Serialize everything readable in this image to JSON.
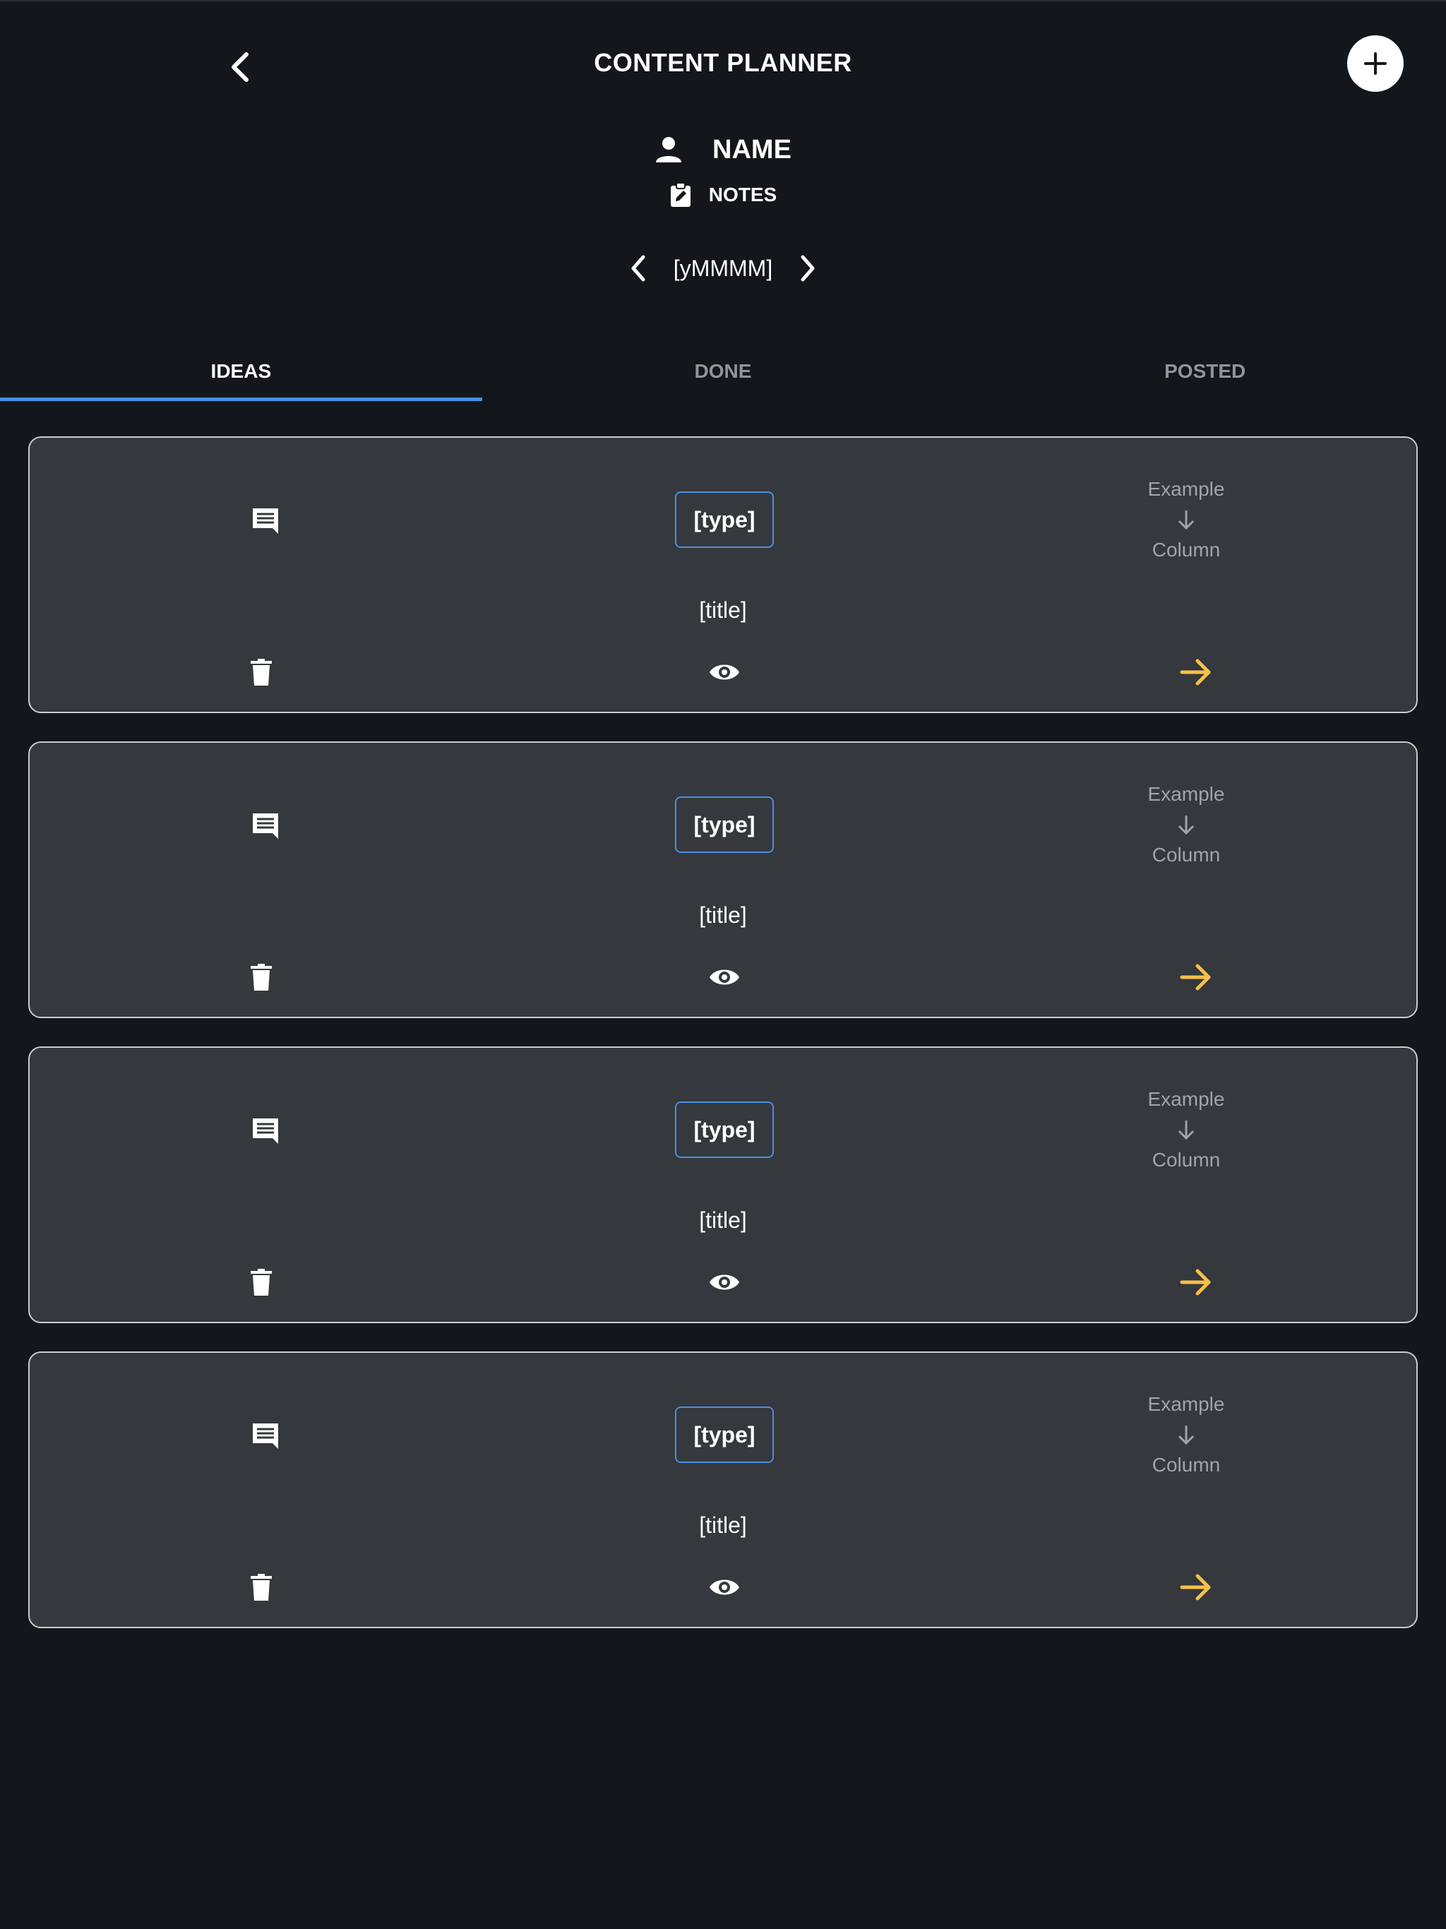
{
  "header": {
    "title": "CONTENT PLANNER",
    "back_icon": "chevron-left-icon",
    "add_icon": "plus-icon"
  },
  "profile": {
    "name": "NAME",
    "notes_label": "NOTES"
  },
  "month_nav": {
    "label": "[yMMMM]"
  },
  "tabs": [
    {
      "label": "IDEAS",
      "active": true
    },
    {
      "label": "DONE",
      "active": false
    },
    {
      "label": "POSTED",
      "active": false
    }
  ],
  "cards": [
    {
      "type": "[type]",
      "title": "[title]",
      "column_from": "Example",
      "column_to": "Column"
    },
    {
      "type": "[type]",
      "title": "[title]",
      "column_from": "Example",
      "column_to": "Column"
    },
    {
      "type": "[type]",
      "title": "[title]",
      "column_from": "Example",
      "column_to": "Column"
    },
    {
      "type": "[type]",
      "title": "[title]",
      "column_from": "Example",
      "column_to": "Column"
    }
  ],
  "colors": {
    "background": "#13171b",
    "card_background": "#35383c",
    "card_border": "#c9ccd0",
    "accent_blue": "#4a8fe7",
    "move_arrow_yellow": "#f7c04a",
    "muted_text": "#a0a5aa"
  }
}
